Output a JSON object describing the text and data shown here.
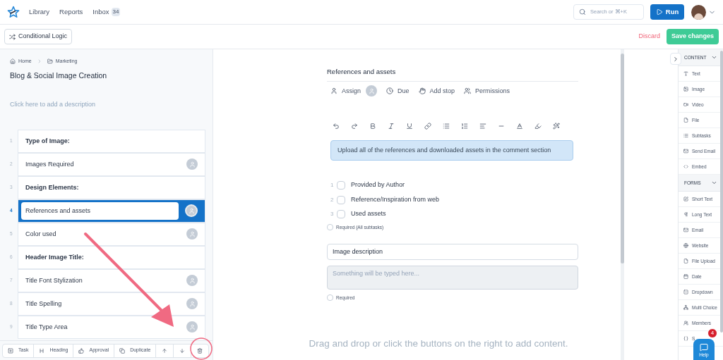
{
  "nav": {
    "links": [
      {
        "label": "Library"
      },
      {
        "label": "Reports"
      },
      {
        "label": "Inbox",
        "badge": "34"
      }
    ],
    "search": {
      "placeholder": "Search or ⌘+K"
    },
    "run": "Run"
  },
  "toolbar": {
    "logic": "Conditional Logic",
    "discard": "Discard",
    "save": "Save changes"
  },
  "sidebar": {
    "breadcrumbs": [
      "Home",
      "Marketing"
    ],
    "title": "Blog & Social Image Creation",
    "description_placeholder": "Click here to add a description",
    "steps": [
      {
        "number": "1",
        "label": "Type of Image:",
        "kind": "heading",
        "selected": false
      },
      {
        "number": "2",
        "label": "Images Required",
        "kind": "task",
        "selected": false
      },
      {
        "number": "3",
        "label": "Design Elements:",
        "kind": "heading",
        "selected": false
      },
      {
        "number": "4",
        "label": "References and assets",
        "kind": "task",
        "selected": true
      },
      {
        "number": "5",
        "label": "Color used",
        "kind": "task",
        "selected": false
      },
      {
        "number": "6",
        "label": "Header Image Title:",
        "kind": "heading",
        "selected": false
      },
      {
        "number": "7",
        "label": "Title Font Stylization",
        "kind": "task",
        "selected": false
      },
      {
        "number": "8",
        "label": "Title Spelling",
        "kind": "task",
        "selected": false
      },
      {
        "number": "9",
        "label": "Title Type Area",
        "kind": "task",
        "selected": false
      }
    ],
    "actions": [
      {
        "label": "Task",
        "kind": "task"
      },
      {
        "label": "Heading",
        "kind": "heading"
      },
      {
        "label": "Approval",
        "kind": "approval"
      },
      {
        "label": "Duplicate",
        "kind": "duplicate"
      },
      {
        "kind": "up"
      },
      {
        "kind": "down"
      },
      {
        "kind": "delete"
      }
    ]
  },
  "editor": {
    "title": "References and assets",
    "meta": [
      {
        "label": "Assign",
        "kind": "assign"
      },
      {
        "label": "Due",
        "kind": "due"
      },
      {
        "label": "Add stop",
        "kind": "stop"
      },
      {
        "label": "Permissions",
        "kind": "permissions"
      }
    ],
    "callout": "Upload all of the references and downloaded assets in the comment section",
    "subtasks": [
      {
        "number": "1",
        "label": "Provided by Author",
        "checked": false
      },
      {
        "number": "2",
        "label": "Reference/Inspiration from web",
        "checked": false
      },
      {
        "number": "3",
        "label": "Used assets",
        "checked": false
      }
    ],
    "subtasks_required": {
      "label": "Required (All subtasks)",
      "checked": false
    },
    "field": {
      "value": "Image description",
      "placeholder": "Something will be typed here...",
      "required": {
        "label": "Required",
        "checked": false
      }
    },
    "drop_hint": "Drag and drop or click the buttons on the right to add content."
  },
  "panel": {
    "sections": [
      {
        "title": "CONTENT",
        "expanded": true,
        "items": [
          {
            "label": "Text",
            "kind": "text"
          },
          {
            "label": "Image",
            "kind": "image"
          },
          {
            "label": "Video",
            "kind": "video"
          },
          {
            "label": "File",
            "kind": "file"
          },
          {
            "label": "Subtasks",
            "kind": "list"
          },
          {
            "label": "Send Email",
            "kind": "mail"
          },
          {
            "label": "Embed",
            "kind": "code"
          }
        ]
      },
      {
        "title": "FORMS",
        "expanded": true,
        "items": [
          {
            "label": "Short Text",
            "kind": "edit"
          },
          {
            "label": "Long Text",
            "kind": "para"
          },
          {
            "label": "Email",
            "kind": "mail"
          },
          {
            "label": "Website",
            "kind": "globe"
          },
          {
            "label": "File Upload",
            "kind": "file"
          },
          {
            "label": "Date",
            "kind": "date"
          },
          {
            "label": "Dropdown",
            "kind": "dropdown"
          },
          {
            "label": "Multi Choice",
            "kind": "multi"
          },
          {
            "label": "Members",
            "kind": "members"
          },
          {
            "label": "S",
            "kind": "braces"
          }
        ]
      }
    ]
  },
  "help": {
    "label": "Help",
    "badge": "4"
  }
}
